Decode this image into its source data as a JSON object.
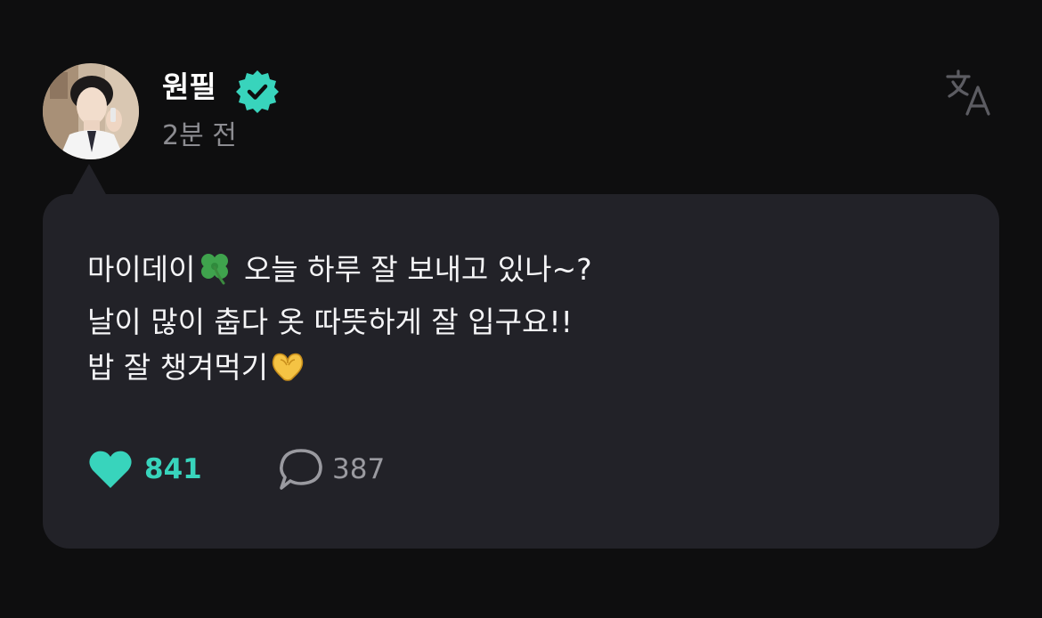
{
  "post": {
    "author_name": "원필",
    "verified": true,
    "timestamp": "2분 전",
    "avatar_icon": "avatar-photo",
    "translate_icon": "translate-icon",
    "body": {
      "line1_before_emoji": "마이데이",
      "line1_emoji": "four-leaf-clover",
      "line1_after_emoji": " 오늘 하루 잘 보내고 있나~?",
      "line2": "날이 많이 춥다 옷 따뜻하게 잘 입구요!!",
      "line3_before_emoji": "밥 잘 챙겨먹기",
      "line3_emoji": "heart-hands"
    },
    "likes": {
      "count": "841",
      "icon": "heart-icon",
      "color": "#38d4bc"
    },
    "comments": {
      "count": "387",
      "icon": "comment-bubble-icon"
    }
  },
  "colors": {
    "background": "#0e0e0f",
    "bubble": "#222228",
    "accent": "#38d4bc",
    "muted_text": "#8c8c91"
  }
}
